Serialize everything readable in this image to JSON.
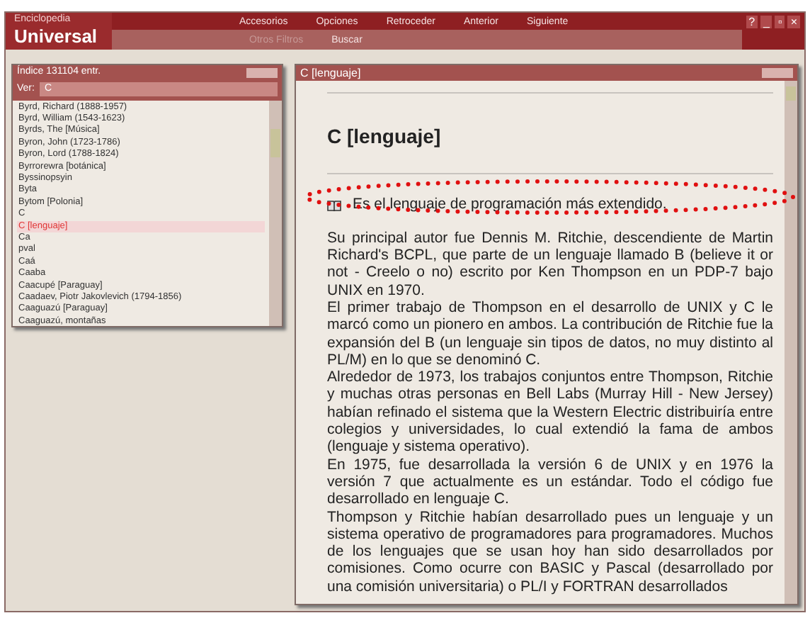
{
  "app": {
    "title_small": "Enciclopedia",
    "title_big": "Universal"
  },
  "menu": [
    {
      "label": "Accesorios",
      "disabled": false
    },
    {
      "label": "Opciones",
      "disabled": false
    },
    {
      "label": "Retroceder",
      "disabled": false
    },
    {
      "label": "Anterior",
      "disabled": false
    },
    {
      "label": "Siguiente",
      "disabled": false
    }
  ],
  "submenu": [
    {
      "label": "Otros Filtros",
      "disabled": true
    },
    {
      "label": "Buscar",
      "disabled": false
    }
  ],
  "window_controls": [
    "?",
    "_",
    "▫",
    "×"
  ],
  "index_panel": {
    "title": "Índice 131104 entr.",
    "filter_label": "Ver:",
    "filter_value": "C",
    "items": [
      {
        "label": "Byrd, Richard (1888-1957)",
        "selected": false
      },
      {
        "label": "Byrd, William (1543-1623)",
        "selected": false
      },
      {
        "label": "Byrds, The [Música]",
        "selected": false
      },
      {
        "label": "Byron, John (1723-1786)",
        "selected": false
      },
      {
        "label": "Byron, Lord (1788-1824)",
        "selected": false
      },
      {
        "label": "Byrrorewra [botánica]",
        "selected": false
      },
      {
        "label": "Byssinopsyin",
        "selected": false
      },
      {
        "label": "Byta",
        "selected": false
      },
      {
        "label": "Bytom [Polonia]",
        "selected": false
      },
      {
        "label": "C",
        "selected": false
      },
      {
        "label": "C [lenguaje]",
        "selected": true
      },
      {
        "label": "Ca",
        "selected": false
      },
      {
        "label": "pval",
        "selected": false
      },
      {
        "label": "Caá",
        "selected": false
      },
      {
        "label": "Caaba",
        "selected": false
      },
      {
        "label": "Caacupé [Paraguay]",
        "selected": false
      },
      {
        "label": "Caadaev, Piotr Jakovlevich (1794-1856)",
        "selected": false
      },
      {
        "label": "Caaguazú [Paraguay]",
        "selected": false
      },
      {
        "label": "Caaguazú, montañas",
        "selected": false
      }
    ]
  },
  "article_panel": {
    "title": "C [lenguaje]",
    "heading": "C [lenguaje]",
    "lead": "Es el lenguaje de programación más extendido.",
    "paragraphs": [
      "Su principal autor fue Dennis M. Ritchie, descendiente de Martin Richard's BCPL, que parte de un lenguaje llamado B (believe it or not - Creelo o no) escrito por Ken Thompson en un PDP-7 bajo UNIX en 1970.",
      "El primer trabajo de Thompson en el desarrollo de UNIX y C le marcó como un pionero en ambos. La contribución de Ritchie fue la expansión del B (un lenguaje sin tipos de datos, no muy distinto al PL/M) en lo que se denominó C.",
      "Alrededor de 1973, los trabajos conjuntos entre Thompson, Ritchie y muchas otras personas en Bell Labs (Murray Hill - New Jersey) habían refinado el sistema que la Western Electric distribuiría entre colegios y universidades, lo cual extendió la fama de ambos (lenguaje y sistema operativo).",
      "En 1975, fue desarrollada la versión 6 de UNIX y en 1976 la versión 7 que actualmente es un estándar. Todo el código fue desarrollado en lenguaje C.",
      "Thompson y Ritchie habían desarrollado pues un lenguaje y un sistema operativo de programadores para programadores. Muchos de los lenguajes que se usan hoy han sido desarrollados por comisiones. Como ocurre con BASIC y Pascal (desarrollado por una comisión universitaria) o PL/I y FORTRAN desarrollados"
    ]
  }
}
